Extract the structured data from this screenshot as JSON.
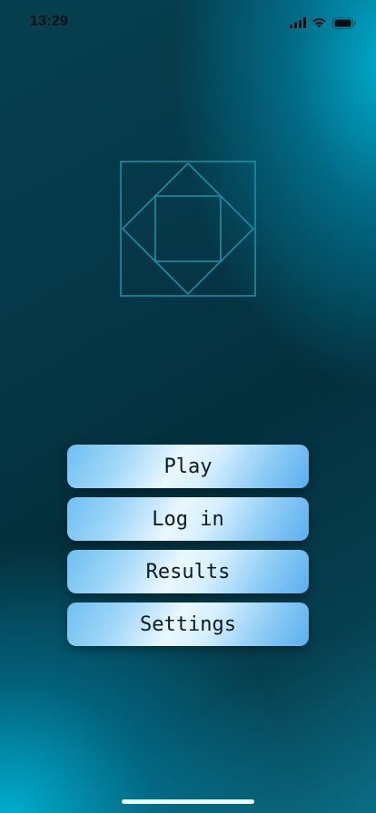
{
  "status_bar": {
    "time": "13:29",
    "icons": [
      "cellular-signal-icon",
      "wifi-icon",
      "battery-icon"
    ]
  },
  "logo": {
    "icon": "nested-square-diamond-logo",
    "color": "#1a8fa3"
  },
  "menu": {
    "items": [
      {
        "label": "Play"
      },
      {
        "label": "Log in"
      },
      {
        "label": "Results"
      },
      {
        "label": "Settings"
      }
    ]
  },
  "colors": {
    "background_dark": "#04303d",
    "background_accent": "#00b4d7",
    "button_light": "#eaf7ff",
    "button_blue": "#5aaef0"
  }
}
